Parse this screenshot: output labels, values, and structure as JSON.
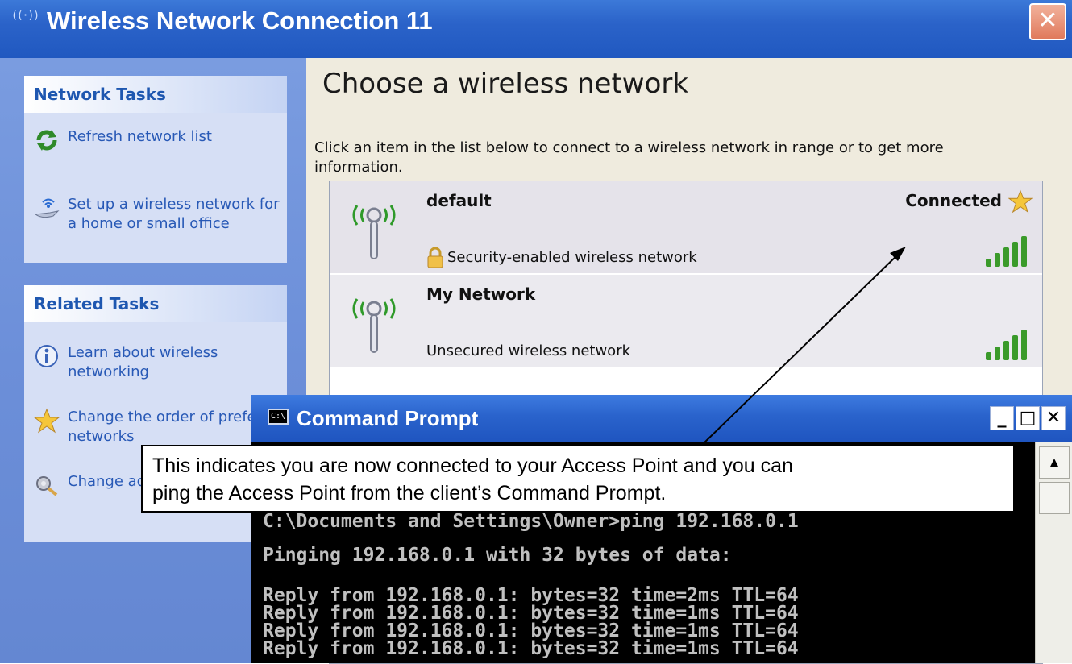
{
  "window": {
    "title": "Wireless Network Connection 11",
    "title_icon_text": "((·))",
    "close_glyph": "✕"
  },
  "sidebar": {
    "network_tasks": {
      "header": "Network Tasks",
      "items": [
        {
          "icon": "refresh-icon",
          "label": "Refresh network list"
        },
        {
          "icon": "wireless-setup-icon",
          "label": "Set up a wireless network for a home or small office"
        }
      ]
    },
    "related_tasks": {
      "header": "Related Tasks",
      "items": [
        {
          "icon": "info-icon",
          "label": "Learn about wireless networking"
        },
        {
          "icon": "star-icon",
          "label": "Change the order of preferred networks"
        },
        {
          "icon": "settings-icon",
          "label": "Change advanced settings"
        }
      ]
    }
  },
  "main": {
    "heading": "Choose a wireless network",
    "description": "Click an item in the list below to connect to a wireless network in range or to get more information.",
    "networks": [
      {
        "name": "default",
        "status": "Connected",
        "security": "Security-enabled wireless network",
        "signal_bars": 5,
        "selected": true
      },
      {
        "name": "My Network",
        "status": "",
        "security": "Unsecured wireless network",
        "signal_bars": 5,
        "selected": false
      }
    ]
  },
  "cmd": {
    "title": "Command Prompt",
    "icon_text": "C:\\",
    "minimize_glyph": "_",
    "maximize_glyph": "□",
    "close_glyph": "✕",
    "lines": [
      "C:\\Documents and Settings\\Owner>ping 192.168.0.1",
      "Pinging 192.168.0.1 with 32 bytes of data:",
      "Reply from 192.168.0.1: bytes=32 time=2ms TTL=64",
      "Reply from 192.168.0.1: bytes=32 time=1ms TTL=64",
      "Reply from 192.168.0.1: bytes=32 time=1ms TTL=64",
      "Reply from 192.168.0.1: bytes=32 time=1ms TTL=64"
    ],
    "scroll_up_glyph": "▲"
  },
  "callout": {
    "line1": "This indicates you are now connected to your Access Point and you can",
    "line2": "ping the Access Point from the client’s Command Prompt."
  },
  "colors": {
    "titlebar": "#2b63c9",
    "sidebar": "#6c8fd9",
    "task_link": "#2859b6",
    "content_bg": "#efebde",
    "selected_row": "#e5e3ea",
    "signal_green": "#3a9a2a"
  }
}
